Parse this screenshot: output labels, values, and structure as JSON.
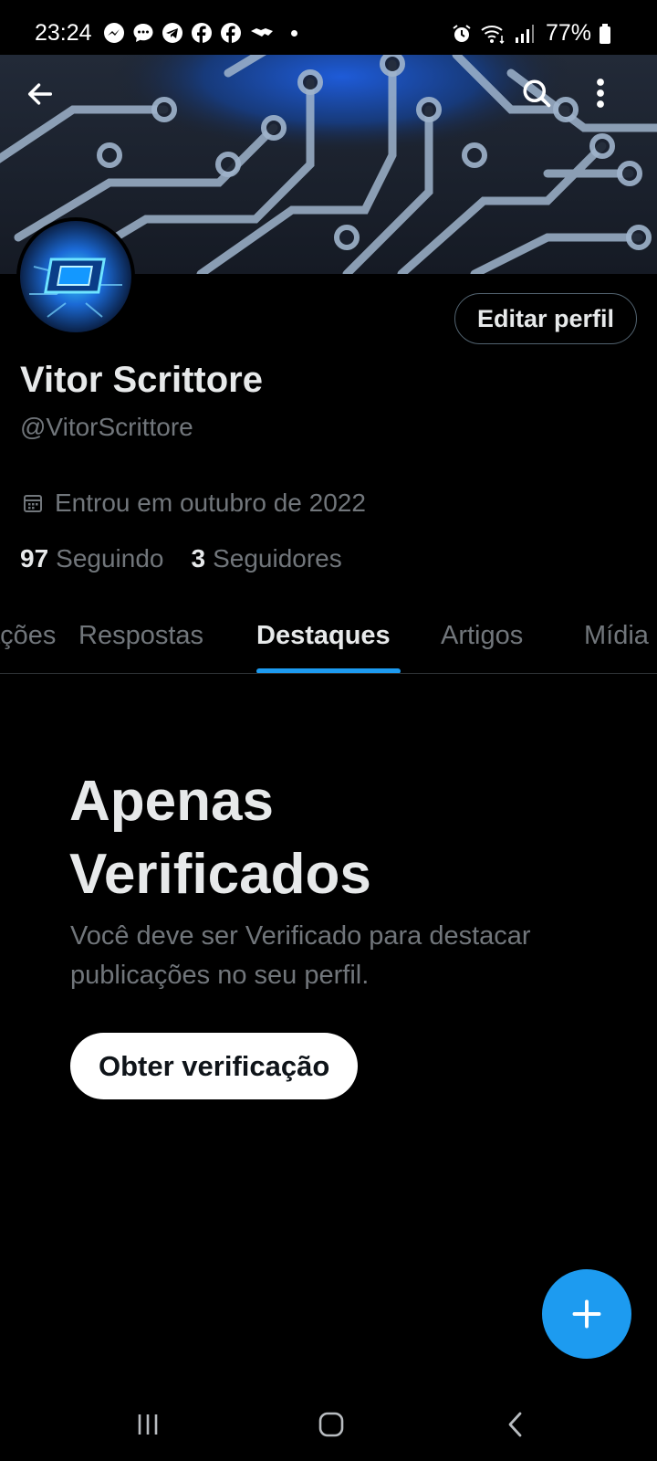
{
  "status_bar": {
    "time": "23:24",
    "battery": "77%",
    "notification_icons": [
      "messenger-icon",
      "chat-icon",
      "telegram-icon",
      "facebook-icon",
      "facebook-icon",
      "handshake-icon"
    ],
    "system_icons": [
      "alarm-icon",
      "wifi-icon",
      "signal-icon",
      "battery-icon"
    ]
  },
  "header": {
    "back_icon": "arrow-left-icon",
    "search_icon": "search-icon",
    "more_icon": "more-vertical-icon"
  },
  "profile": {
    "edit_button": "Editar perfil",
    "name": "Vitor Scrittore",
    "handle": "@VitorScrittore",
    "joined": "Entrou em outubro de 2022",
    "following_count": "97",
    "following_label": "Seguindo",
    "followers_count": "3",
    "followers_label": "Seguidores"
  },
  "tabs": [
    {
      "label": "Publicações",
      "active": false
    },
    {
      "label": "Respostas",
      "active": false
    },
    {
      "label": "Destaques",
      "active": true
    },
    {
      "label": "Artigos",
      "active": false
    },
    {
      "label": "Mídia",
      "active": false
    }
  ],
  "empty_state": {
    "title_line1": "Apenas",
    "title_line2": "Verificados",
    "desc_line1": "Você deve ser Verificado para destacar",
    "desc_line2": "publicações no seu perfil.",
    "button": "Obter verificação"
  },
  "fab_icon": "plus-icon",
  "colors": {
    "background": "#000000",
    "accent": "#1d9bf0",
    "text_primary": "#e7e9ea",
    "text_secondary": "#71767b",
    "border": "#2f3336"
  },
  "nav_bar": [
    "recents-icon",
    "home-icon",
    "back-icon"
  ]
}
